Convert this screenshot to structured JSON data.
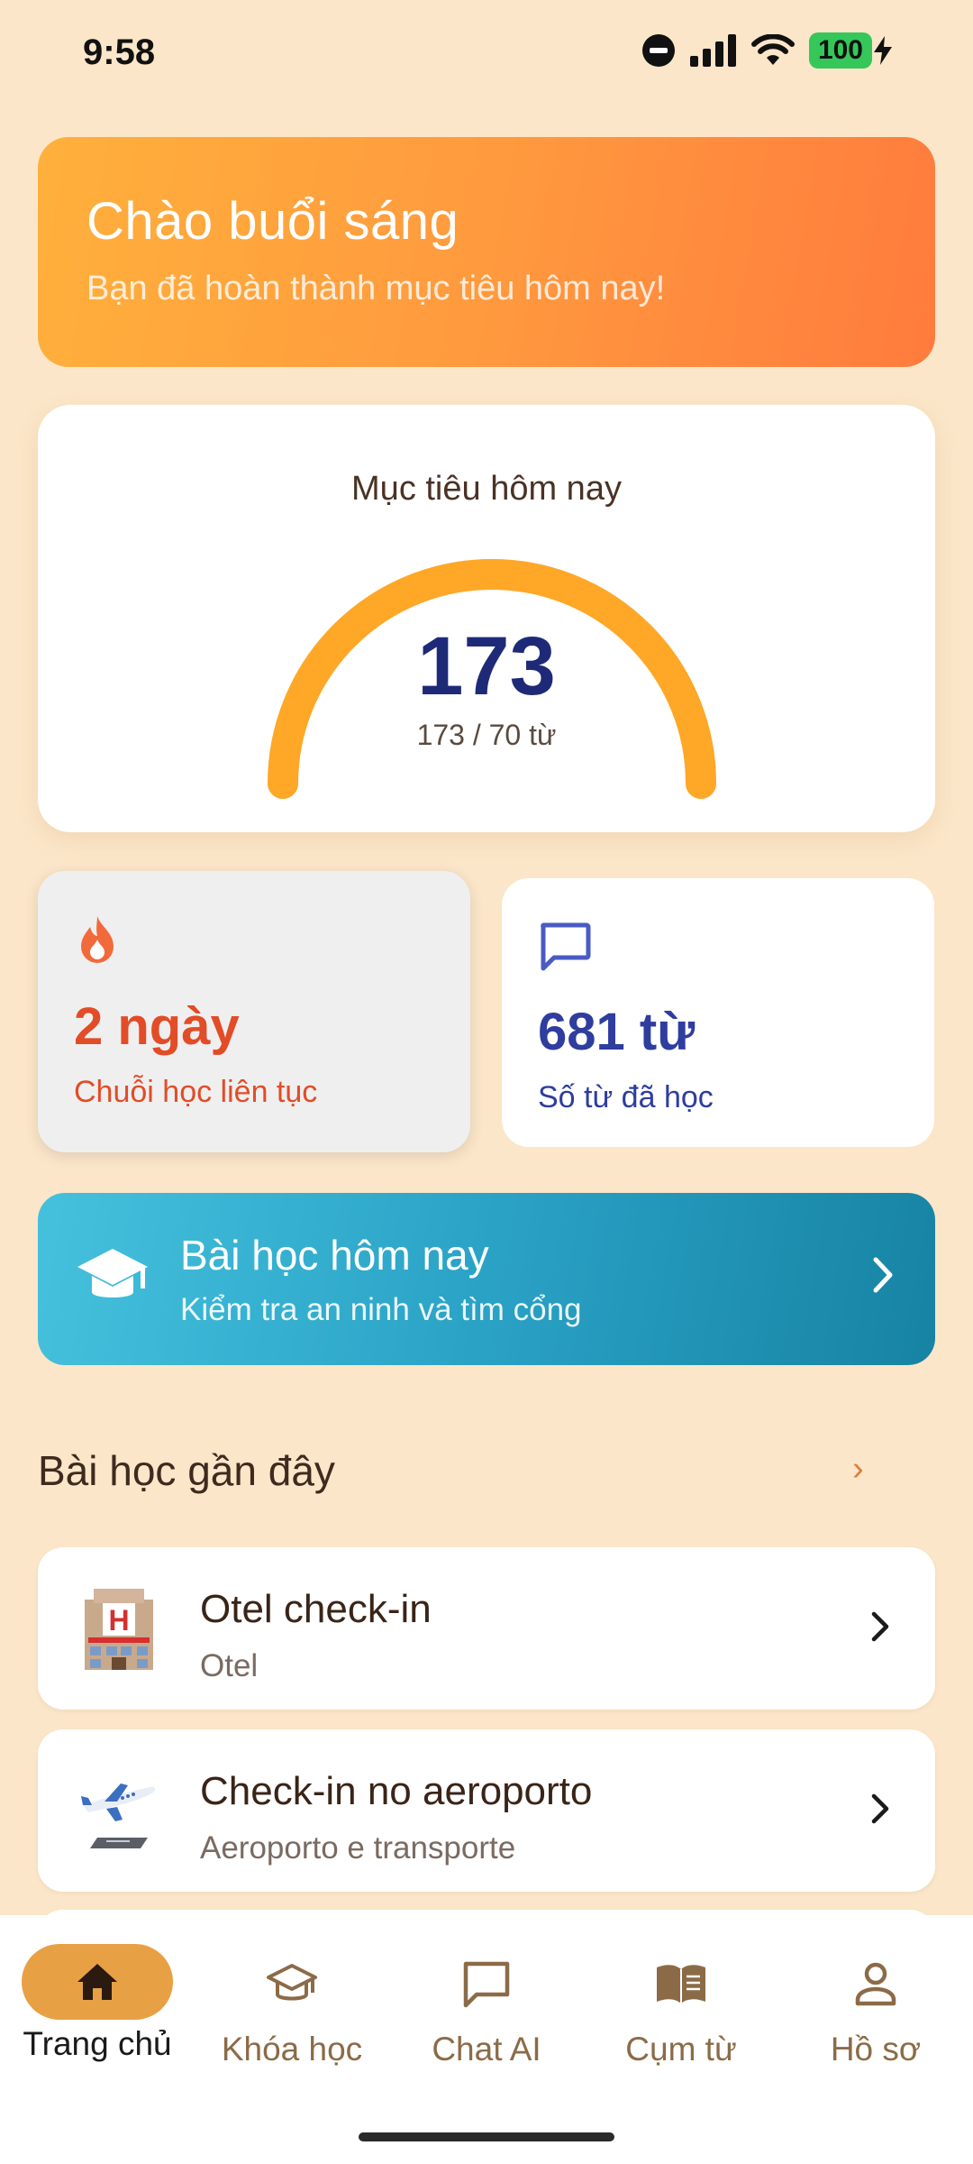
{
  "status_bar": {
    "time": "9:58",
    "battery": "100"
  },
  "greeting": {
    "title": "Chào buổi sáng",
    "subtitle": "Bạn đã hoàn thành mục tiêu hôm nay!"
  },
  "daily_goal": {
    "title": "Mục tiêu hôm nay",
    "value": "173",
    "detail": "173 / 70 từ",
    "progress": 1.0,
    "arc_color": "#FFA726"
  },
  "streak": {
    "value": "2 ngày",
    "label": "Chuỗi học liên tục",
    "icon": "flame-icon"
  },
  "words_learned": {
    "value": "681 từ",
    "label": "Số từ đã học",
    "icon": "chat-bubble-icon"
  },
  "today_lesson": {
    "title": "Bài học hôm nay",
    "subtitle": "Kiểm tra an ninh và tìm cổng",
    "icon": "graduation-cap-icon"
  },
  "recent_lessons": {
    "heading": "Bài học gần đây",
    "more": "›",
    "items": [
      {
        "name": "Otel check-in",
        "category": "Otel",
        "icon": "hotel-icon"
      },
      {
        "name": "Check-in no aeroporto",
        "category": "Aeroporto e transporte",
        "icon": "airplane-icon"
      }
    ]
  },
  "bottom_nav": {
    "tabs": [
      {
        "label": "Trang chủ",
        "icon": "home-icon",
        "active": true
      },
      {
        "label": "Khóa học",
        "icon": "graduation-cap-icon",
        "active": false
      },
      {
        "label": "Chat AI",
        "icon": "chat-bubble-icon",
        "active": false
      },
      {
        "label": "Cụm từ",
        "icon": "book-icon",
        "active": false
      },
      {
        "label": "Hồ sơ",
        "icon": "person-icon",
        "active": false
      }
    ]
  },
  "colors": {
    "background": "#FBE6C9",
    "accent": "#E8A045",
    "streak": "#E24C27",
    "words": "#2E3D9E"
  }
}
